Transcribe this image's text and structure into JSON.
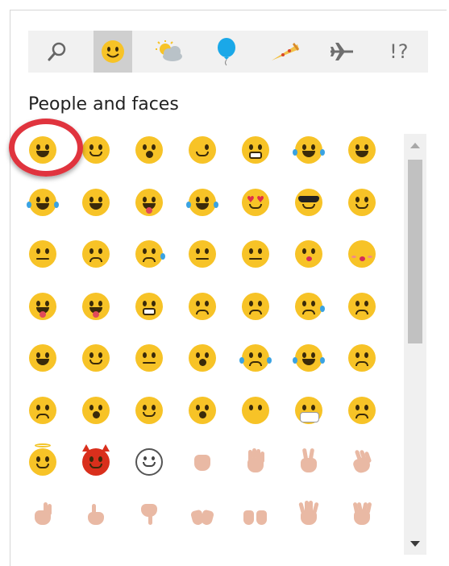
{
  "tabs": [
    {
      "name": "search-icon",
      "label": ""
    },
    {
      "name": "smiley-icon",
      "label": "",
      "active": true
    },
    {
      "name": "weather-icon",
      "label": ""
    },
    {
      "name": "balloon-icon",
      "label": ""
    },
    {
      "name": "pizza-icon",
      "label": ""
    },
    {
      "name": "airplane-icon",
      "label": ""
    },
    {
      "name": "symbols-icon",
      "label": "!?"
    }
  ],
  "section_title": "People and faces",
  "colors": {
    "accent_highlight": "#e0343e",
    "emoji_yellow": "#f7c327",
    "skin_tone": "#e9b9a4"
  },
  "emoji_grid_icons": [
    "grinning-face-icon",
    "slightly-smiling-face-icon",
    "anguished-face-icon",
    "winking-face-icon",
    "grimacing-face-icon",
    "laughing-tears-face-icon",
    "grinning-big-eyes-face-icon",
    "tears-of-joy-face-icon",
    "squinting-laughing-face-icon",
    "face-with-tongue-icon",
    "rolling-on-floor-laughing-icon",
    "heart-eyes-face-icon",
    "sunglasses-face-icon",
    "smirking-face-icon",
    "neutral-face-icon",
    "unamused-face-icon",
    "sweat-face-icon",
    "expressionless-face-icon",
    "hushed-face-icon",
    "kissing-face-icon",
    "kissing-closed-eyes-face-icon",
    "winking-tongue-face-icon",
    "squinting-tongue-face-icon",
    "weary-face-icon",
    "worried-face-icon",
    "frowning-face-icon",
    "crying-face-icon",
    "persevering-face-icon",
    "grin-face-icon",
    "relieved-face-icon",
    "sleepy-face-icon",
    "thinking-face-icon",
    "loudly-crying-face-icon",
    "sobbing-face-icon",
    "confused-face-icon",
    "disappointed-face-icon",
    "astonished-face-icon",
    "drooling-face-icon",
    "dizzy-face-icon",
    "face-without-mouth-icon",
    "medical-mask-face-icon",
    "slightly-frowning-face-icon",
    "halo-face-icon",
    "devil-face-icon",
    "white-smiling-face-icon",
    "raised-fist-icon",
    "raised-hand-icon",
    "victory-hand-icon",
    "waving-hand-icon",
    "ok-hand-icon",
    "thumbs-up-icon",
    "thumbs-down-icon",
    "clapping-hands-icon",
    "open-hands-icon",
    "hand-splayed-icon",
    "vulcan-salute-icon"
  ],
  "scrollbar": {
    "up_icon": "scroll-up-icon",
    "down_icon": "scroll-down-icon"
  }
}
